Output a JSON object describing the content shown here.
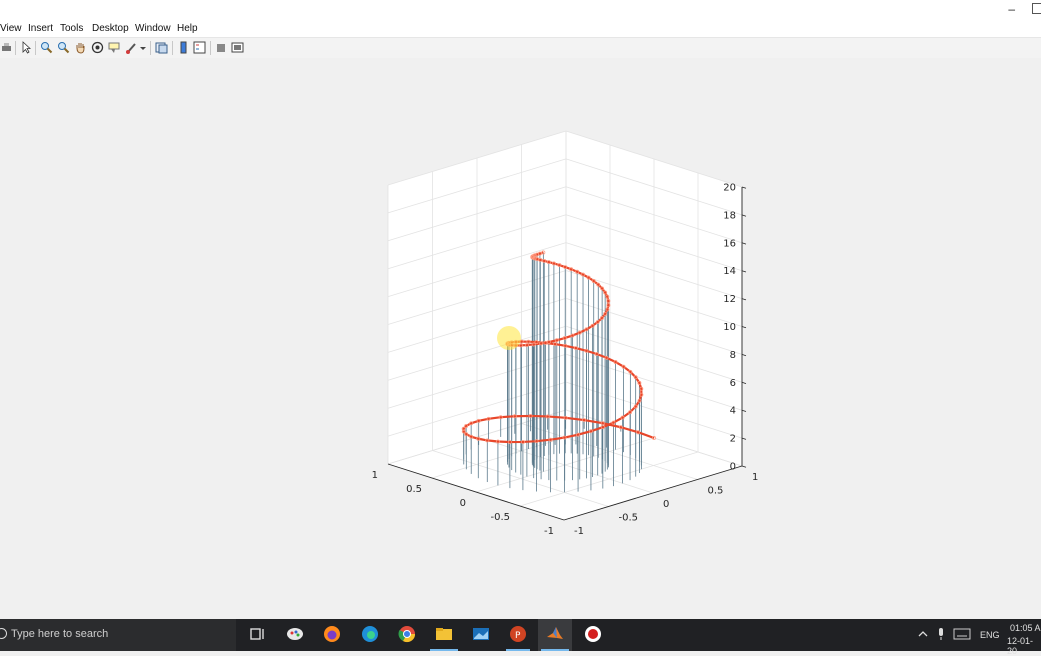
{
  "menu": [
    "View",
    "Insert",
    "Tools",
    "Desktop",
    "Window",
    "Help"
  ],
  "window": {
    "minimize_glyph": "–"
  },
  "toolbar_icons": [
    "print-icon",
    "pointer-icon",
    "zoom-in-icon",
    "zoom-out-icon",
    "pan-icon",
    "rotate-3d-icon",
    "data-cursor-icon",
    "brush-icon",
    "link-plot-icon",
    "insert-colorbar-icon",
    "insert-legend-icon",
    "hide-plot-tools-icon",
    "show-plot-tools-icon"
  ],
  "chart_data": {
    "type": "stem3",
    "description_of_curve": "helix z = t, x = r cos t, y = r sin t with radius shrinking",
    "series": [
      {
        "x_expr": "exp(-0.05 t)·sin t",
        "t_range": [
          0,
          15.7
        ]
      }
    ],
    "colors": {
      "line": "#e8462a",
      "marker": "#e8462a",
      "stem": "#5b7a8c"
    },
    "zlim": [
      0,
      20
    ],
    "z_ticks": [
      "0",
      "2",
      "4",
      "6",
      "8",
      "10",
      "12",
      "14",
      "16",
      "18",
      "20"
    ],
    "x_ticks": [
      "-1",
      "-0.5",
      "0",
      "0.5",
      "1"
    ],
    "y_ticks": [
      "-1",
      "-0.5",
      "0",
      "0.5",
      "1"
    ],
    "grid": true
  },
  "taskbar": {
    "search_placeholder": "Type here to search",
    "language": "ENG",
    "time": "01:05 A",
    "date": "12-01-20"
  }
}
